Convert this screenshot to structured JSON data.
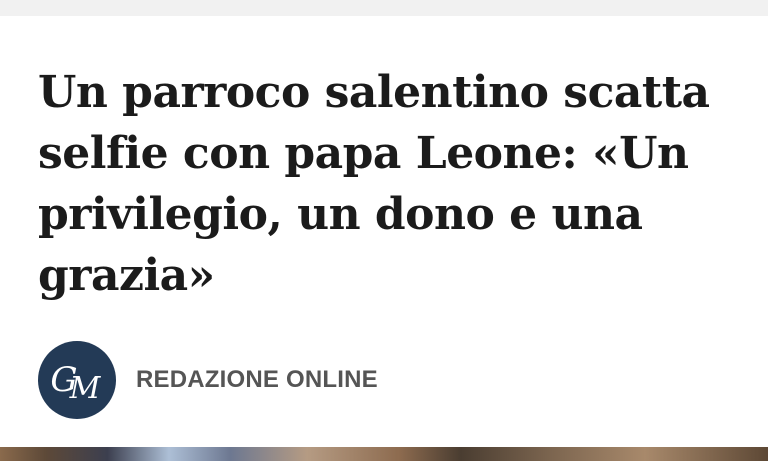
{
  "article": {
    "headline_lines": [
      "Un parroco salentino scatta",
      "selfie con papa Leone: «Un",
      "privilegio, un dono e una",
      "grazia»"
    ],
    "author": "REDAZIONE ONLINE",
    "publisher_logo": {
      "text": "GM",
      "icon": "gazzetta-mezzogiorno-logo-icon",
      "color": "#233a56"
    }
  }
}
